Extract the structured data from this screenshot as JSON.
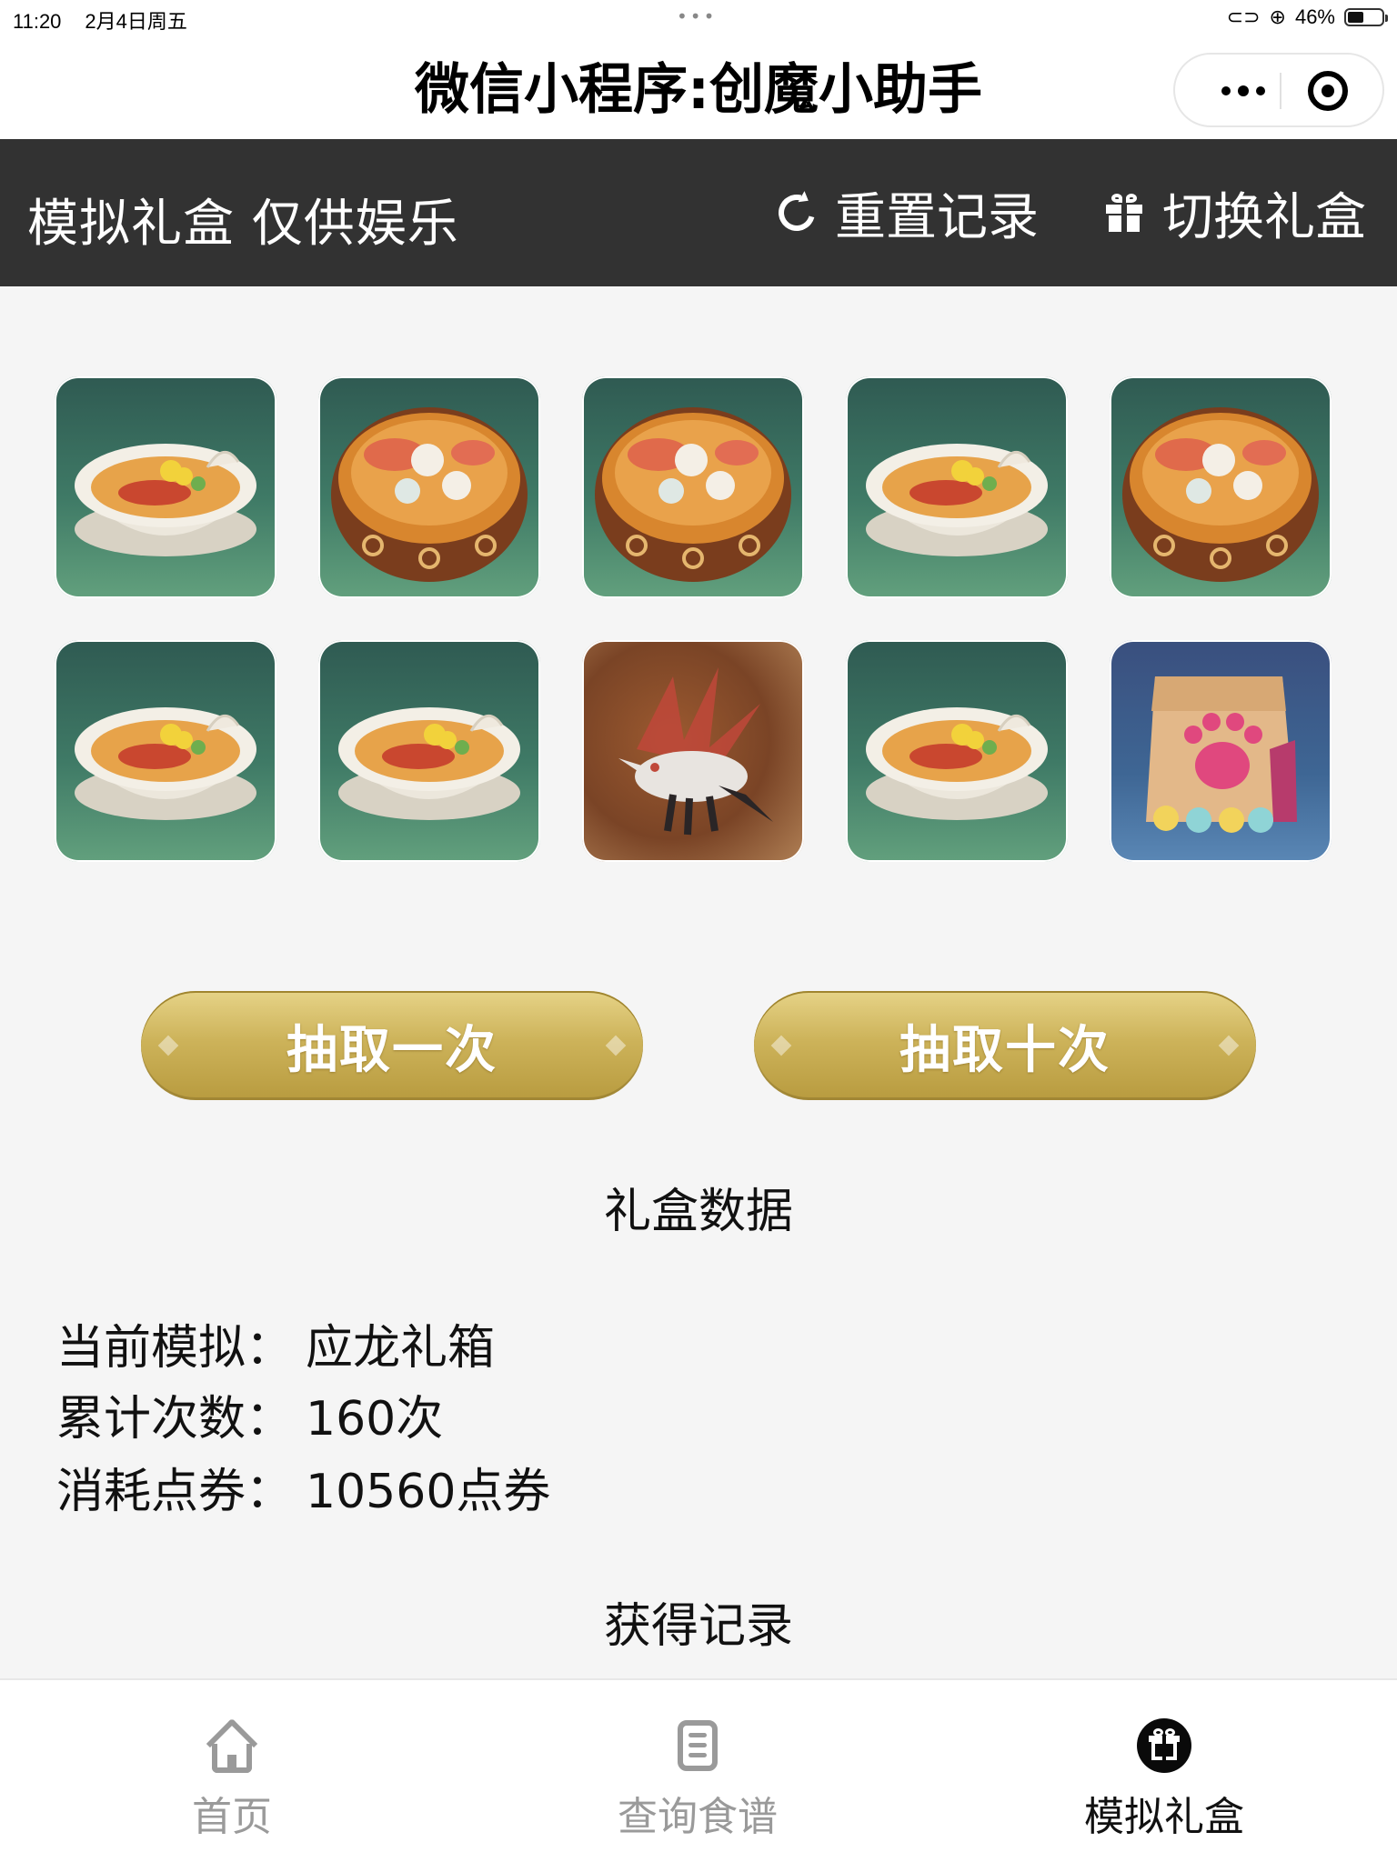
{
  "status_bar": {
    "time": "11:20",
    "date": "2月4日周五",
    "battery_text": "46%",
    "battery_level": 0.46,
    "center_dots": "•••"
  },
  "title_bar": {
    "title": "微信小程序:创魔小助手",
    "more_icon": "more-dots-icon",
    "close_icon": "target-close-icon"
  },
  "toolbar": {
    "title": "模拟礼盒 仅供娱乐",
    "reset_label": "重置记录",
    "reset_icon": "refresh-icon",
    "switch_label": "切换礼盒",
    "switch_icon": "gift-icon"
  },
  "items": [
    {
      "type": "hotpot-bowl"
    },
    {
      "type": "seafood-soup"
    },
    {
      "type": "seafood-soup"
    },
    {
      "type": "hotpot-bowl"
    },
    {
      "type": "seafood-soup"
    },
    {
      "type": "hotpot-bowl"
    },
    {
      "type": "hotpot-bowl"
    },
    {
      "type": "dragon-pet"
    },
    {
      "type": "hotpot-bowl"
    },
    {
      "type": "paw-pet-food-bag"
    }
  ],
  "actions": {
    "draw_once": "抽取一次",
    "draw_ten": "抽取十次"
  },
  "stats": {
    "section_title": "礼盒数据",
    "current_label": "当前模拟：",
    "current_value": "应龙礼箱",
    "count_label": "累计次数：",
    "count_value": "160次",
    "cost_label": "消耗点券：",
    "cost_value": "10560点券"
  },
  "records": {
    "section_title": "获得记录"
  },
  "tabbar": {
    "tabs": [
      {
        "label": "首页",
        "icon": "home-icon",
        "active": false
      },
      {
        "label": "查询食谱",
        "icon": "document-icon",
        "active": false
      },
      {
        "label": "模拟礼盒",
        "icon": "gift-icon",
        "active": true
      }
    ]
  },
  "colors": {
    "toolbar_bg": "#323232",
    "page_bg": "#f5f5f5",
    "button_gold": "#cdb35a",
    "tab_inactive": "#9a9a9a",
    "tab_active": "#111111"
  }
}
